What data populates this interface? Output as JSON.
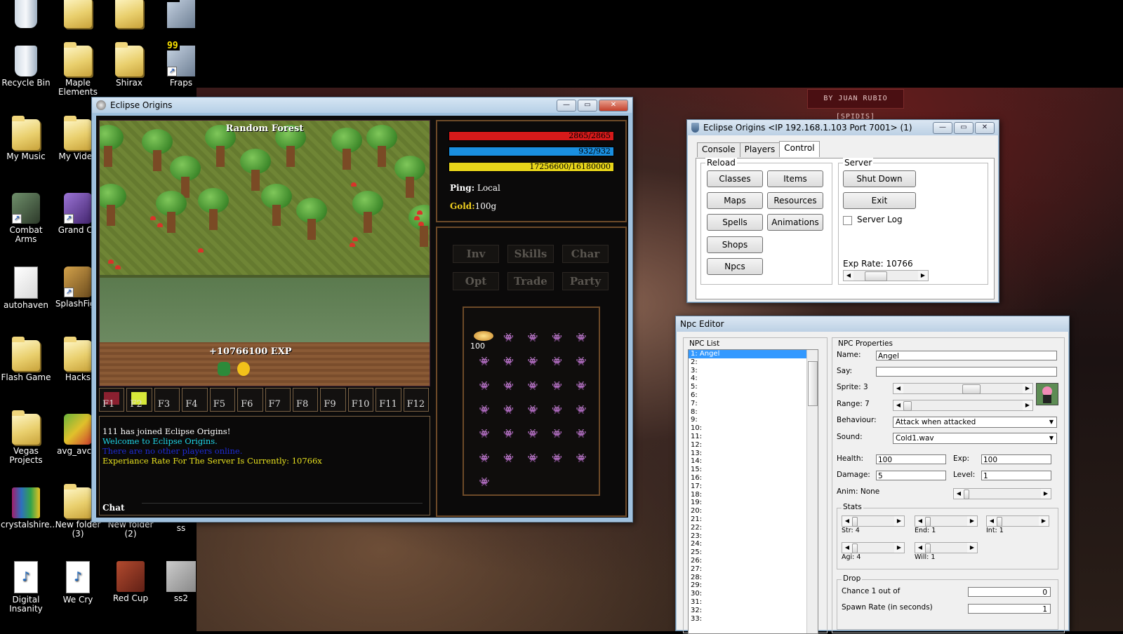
{
  "desktop": {
    "icons": [
      {
        "label": "Recycle Bin",
        "kind": "bin",
        "shortcut": false
      },
      {
        "label": "Maple Elements",
        "kind": "folder",
        "shortcut": false
      },
      {
        "label": "Shirax",
        "kind": "folder",
        "shortcut": false
      },
      {
        "label": "Fraps",
        "kind": "fraps",
        "shortcut": true
      },
      {
        "label": "My Music",
        "kind": "folder",
        "shortcut": false
      },
      {
        "label": "My Video",
        "kind": "folder",
        "shortcut": false
      },
      {
        "label": "Combat Arms",
        "kind": "app-a",
        "shortcut": true
      },
      {
        "label": "Grand Ch",
        "kind": "app-b",
        "shortcut": true
      },
      {
        "label": "autohaven",
        "kind": "app-c",
        "shortcut": false
      },
      {
        "label": "SplashFigh",
        "kind": "app-d",
        "shortcut": true
      },
      {
        "label": "Flash Game",
        "kind": "folder",
        "shortcut": false
      },
      {
        "label": "Hacks",
        "kind": "folder",
        "shortcut": false
      },
      {
        "label": "Vegas Projects",
        "kind": "folder",
        "shortcut": false
      },
      {
        "label": "avg_avct_",
        "kind": "app-e",
        "shortcut": false
      },
      {
        "label": "crystalshire...",
        "kind": "app-f",
        "shortcut": false
      },
      {
        "label": "New folder (3)",
        "kind": "folder",
        "shortcut": false
      },
      {
        "label": "New folder (2)",
        "kind": "folder",
        "shortcut": false
      },
      {
        "label": "ss",
        "kind": "none",
        "shortcut": false
      },
      {
        "label": "Digital Insanity",
        "kind": "mp3",
        "shortcut": false
      },
      {
        "label": "We Cry",
        "kind": "mp3",
        "shortcut": false
      },
      {
        "label": "Red Cup",
        "kind": "app-g",
        "shortcut": false
      },
      {
        "label": "ss2",
        "kind": "app-h",
        "shortcut": false
      }
    ],
    "wallpaper_badge": "BY JUAN RUBIO [SPIDIS]",
    "mp3_glyph": "♪"
  },
  "game": {
    "title": "Eclipse Origins",
    "map_name": "Random Forest",
    "damage_text": "+10766100 EXP",
    "hotkeys": [
      "F1",
      "F2",
      "F3",
      "F4",
      "F5",
      "F6",
      "F7",
      "F8",
      "F9",
      "F10",
      "F11",
      "F12"
    ],
    "chat": {
      "lines": [
        {
          "text": "111 has joined Eclipse Origins!",
          "color": "#ffffff"
        },
        {
          "text": "Welcome to Eclipse Origins.",
          "color": "#1fd7e8"
        },
        {
          "text": "There are no other players online.",
          "color": "#1e2bd6"
        },
        {
          "text": "Experiance Rate For The Server Is Currently: 10766x",
          "color": "#e8e21f"
        }
      ],
      "label": "Chat"
    },
    "stats": {
      "hp": {
        "text": "2865/2865",
        "fill": 1.0,
        "color": "#d61a1a"
      },
      "mp": {
        "text": "932/932",
        "fill": 1.0,
        "color": "#1a8fe0"
      },
      "exp": {
        "text": "17256600/16180000",
        "fill": 1.0,
        "color": "#e8d51a"
      },
      "ping_label": "Ping:",
      "ping_value": "Local",
      "gold_label": "Gold:",
      "gold_value": "100g"
    },
    "menu": [
      "Inv",
      "Skills",
      "Char",
      "Opt",
      "Trade",
      "Party"
    ],
    "inventory": {
      "gold_amount": "100",
      "empty_slot_glyph": "👾",
      "slot_count": 31
    },
    "window_buttons": {
      "min": "—",
      "max": "▭",
      "close": "✕"
    }
  },
  "server": {
    "title": "Eclipse Origins <IP 192.168.1.103 Port 7001> (1)",
    "tabs": [
      "Console",
      "Players",
      "Control"
    ],
    "active_tab": "Control",
    "reload": {
      "label": "Reload",
      "buttons": [
        "Classes",
        "Items",
        "Maps",
        "Resources",
        "Spells",
        "Animations",
        "Shops",
        "Npcs"
      ]
    },
    "server_group": {
      "label": "Server",
      "shutdown": "Shut Down",
      "exit": "Exit",
      "log_label": "Server Log",
      "exp_rate_label": "Exp Rate: 10766",
      "exp_rate_level": 0.25
    }
  },
  "npc_editor": {
    "title": "Npc Editor",
    "list_label": "NPC List",
    "list": [
      "1: Angel",
      "2:",
      "3:",
      "4:",
      "5:",
      "6:",
      "7:",
      "8:",
      "9:",
      "10:",
      "11:",
      "12:",
      "13:",
      "14:",
      "15:",
      "16:",
      "17:",
      "18:",
      "19:",
      "20:",
      "21:",
      "22:",
      "23:",
      "24:",
      "25:",
      "26:",
      "27:",
      "28:",
      "29:",
      "30:",
      "31:",
      "32:",
      "33:"
    ],
    "selected_index": 0,
    "props_label": "NPC Properties",
    "name_label": "Name:",
    "name_value": "Angel",
    "say_label": "Say:",
    "say_value": "",
    "sprite_label": "Sprite: 3",
    "range_label": "Range: 7",
    "behaviour_label": "Behaviour:",
    "behaviour_value": "Attack when attacked",
    "sound_label": "Sound:",
    "sound_value": "Cold1.wav",
    "health_label": "Health:",
    "health_value": "100",
    "exp_label": "Exp:",
    "exp_value": "100",
    "damage_label": "Damage:",
    "damage_value": "5",
    "level_label": "Level:",
    "level_value": "1",
    "anim_label": "Anim: None",
    "stats_label": "Stats",
    "stats": [
      "Str: 4",
      "End: 1",
      "Int: 1",
      "Agi: 4",
      "Will: 1"
    ],
    "drop_label": "Drop",
    "chance_label": "Chance 1 out of",
    "chance_value": "0",
    "spawn_label": "Spawn Rate (in seconds)",
    "spawn_value": "1"
  }
}
